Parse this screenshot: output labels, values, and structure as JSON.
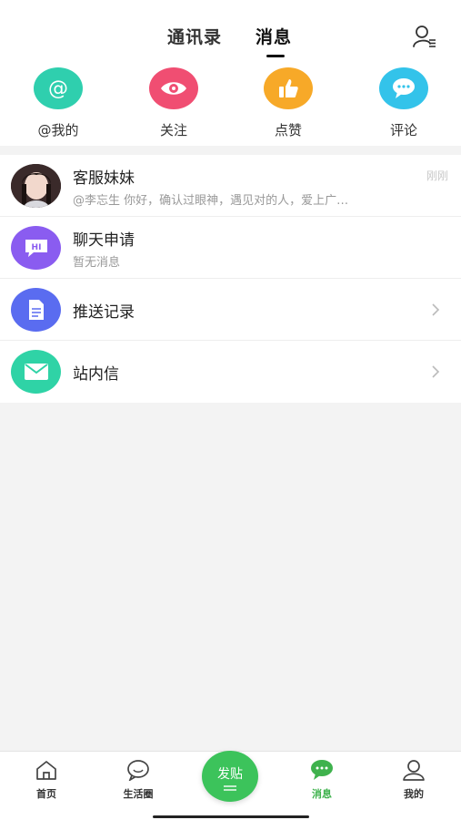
{
  "header": {
    "tabs": [
      {
        "label": "通讯录"
      },
      {
        "label": "消息"
      }
    ],
    "contacts_icon": "contacts-list-icon"
  },
  "quick_actions": [
    {
      "label": "@我的",
      "icon": "at-icon",
      "color": "#2fcfae"
    },
    {
      "label": "关注",
      "icon": "eye-icon",
      "color": "#f04e72"
    },
    {
      "label": "点赞",
      "icon": "thumbs-up-icon",
      "color": "#f7a928"
    },
    {
      "label": "评论",
      "icon": "comment-icon",
      "color": "#33c3ea"
    }
  ],
  "messages": [
    {
      "title": "客服妹妹",
      "preview": "@李忘生 你好，确认过眼神，遇见对的人，爱上广…",
      "time": "刚刚",
      "icon": "avatar"
    },
    {
      "title": "聊天申请",
      "preview": "暂无消息",
      "icon": "hi-chat-icon",
      "color": "#8a5cf0"
    },
    {
      "title": "推送记录",
      "icon": "document-icon",
      "color": "#5a6cf0"
    },
    {
      "title": "站内信",
      "icon": "mail-icon",
      "color": "#2fd3a6"
    }
  ],
  "bottom_nav": {
    "items": [
      {
        "label": "首页",
        "icon": "home-icon"
      },
      {
        "label": "生活圈",
        "icon": "chat-bubble-icon"
      },
      {
        "label": "消息",
        "icon": "message-icon",
        "active": true
      },
      {
        "label": "我的",
        "icon": "profile-icon"
      }
    ],
    "post_label": "发贴",
    "active_color": "#3fb24d"
  }
}
